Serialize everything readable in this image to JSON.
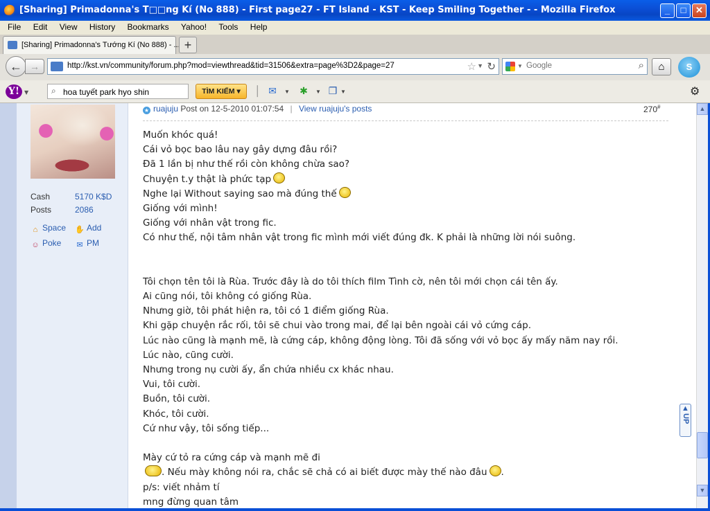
{
  "window": {
    "title": "[Sharing] Primadonna's T□□ng Kí (No 888) - First page27 - FT Island - KST - Keep Smiling Together - - Mozilla Firefox",
    "min": "_",
    "max": "□",
    "close": "✕"
  },
  "menu": [
    "File",
    "Edit",
    "View",
    "History",
    "Bookmarks",
    "Yahoo!",
    "Tools",
    "Help"
  ],
  "tab": {
    "label": "[Sharing] Primadonna's Tướng Kí (No 888) - ...",
    "new": "+"
  },
  "nav": {
    "url": "http://kst.vn/community/forum.php?mod=viewthread&tid=31506&extra=page%3D2&page=27",
    "search_placeholder": "Google"
  },
  "yahoo": {
    "logo": "Y!",
    "search_value": "hoa tuyết park hyo shin",
    "button": "TÌM KIẾM ▾"
  },
  "sidebar": {
    "cash_label": "Cash",
    "cash_value": "5170 K$D",
    "posts_label": "Posts",
    "posts_value": "2086",
    "space": "Space",
    "add": "Add",
    "poke": "Poke",
    "pm": "PM"
  },
  "post": {
    "author": "ruajuju",
    "posted_on": "Post on 12-5-2010 01:07:54",
    "view_link": "View ruajuju's posts",
    "number": "270",
    "number_sup": "#",
    "lines": [
      "Muốn khóc quá!",
      "Cái vỏ bọc bao lâu nay gây dựng đâu rồi?",
      "Đã 1 lần bị như thế rồi còn không chừa sao?",
      "Chuyện t.y thật là phức tạp",
      "Nghe lại Without saying sao mà đúng thế",
      "Giống với mình!",
      "Giống với nhân vật trong fic.",
      "Có như thế, nội tâm nhân vật trong fic mình mới viết đúng đk. K phải là những lời nói suông.",
      "",
      "",
      "Tôi chọn tên tôi là Rùa. Trước đây là do tôi thích film Tình cờ, nên tôi mới chọn cái tên ấy.",
      "Ai cũng nói, tôi không có giống Rùa.",
      "Nhưng giờ, tôi phát hiện ra, tôi có 1 điểm giống Rùa.",
      "Khi gặp chuyện rắc rối, tôi sẽ chui vào trong mai, để lại bên ngoài cái vỏ cứng cáp.",
      "Lúc nào cũng là mạnh mẽ, là cứng cáp, không động lòng. Tôi đã sống với vỏ bọc ấy mấy năm nay rồi.",
      "Lúc nào, cũng cười.",
      "Nhưng trong nụ cười ấy, ẩn chứa nhiều cx khác nhau.",
      "Vui, tôi cười.",
      "Buồn, tôi cười.",
      "Khóc, tôi cười.",
      "Cứ như vậy, tôi sống tiếp...",
      "",
      "Mày cứ tỏ ra cứng cáp và mạnh mẽ đi",
      "",
      "p/s: viết nhảm tí",
      "mng đừng quan tâm"
    ],
    "line_23_tail": ". Nếu mày không nói ra, chắc sẽ chả có ai biết được mày thế nào đâu",
    "line_23_end": "."
  },
  "up_tab": "UP"
}
